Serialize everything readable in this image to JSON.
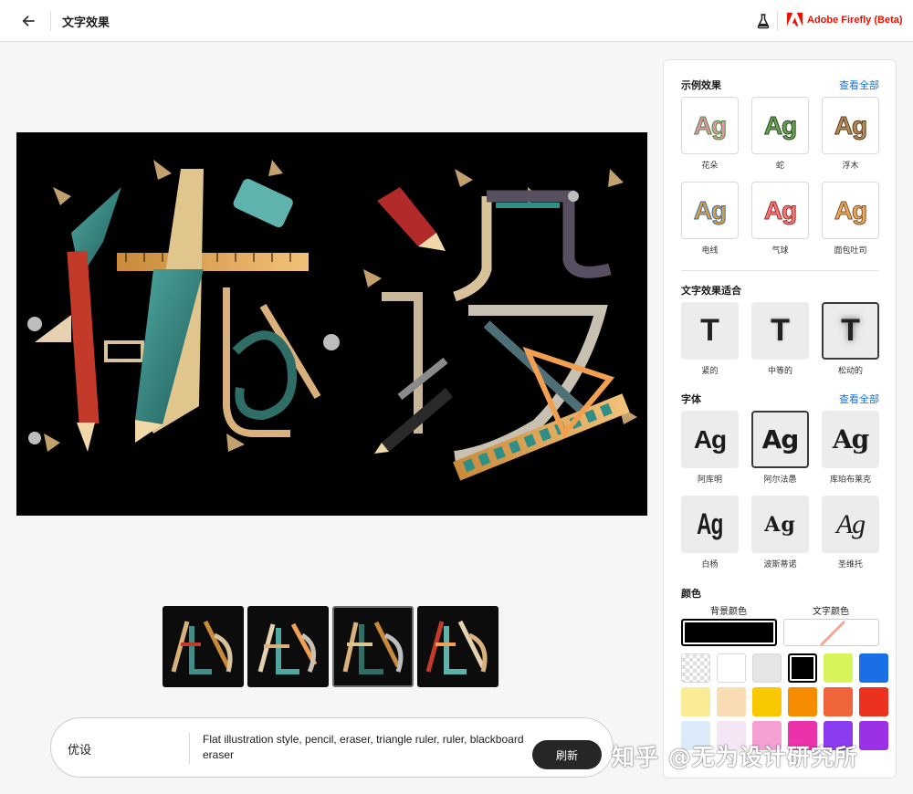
{
  "header": {
    "page_title": "文字效果",
    "brand_name": "Adobe Firefly (Beta)"
  },
  "colors": {
    "brand_red": "#eb1000",
    "link_blue": "#1473e6",
    "main_bg": "#000000"
  },
  "prompt": {
    "text": "优设",
    "description": "Flat illustration style, pencil, eraser, triangle ruler, ruler, blackboard eraser",
    "refresh_label": "刷新"
  },
  "panel": {
    "examples": {
      "title": "示例效果",
      "view_all": "查看全部",
      "items": [
        {
          "label": "花朵"
        },
        {
          "label": "蛇"
        },
        {
          "label": "浮木"
        },
        {
          "label": "电线"
        },
        {
          "label": "气球"
        },
        {
          "label": "面包吐司"
        }
      ]
    },
    "fit": {
      "title": "文字效果适合",
      "items": [
        {
          "label": "紧的"
        },
        {
          "label": "中等的"
        },
        {
          "label": "松动的",
          "selected": true
        }
      ]
    },
    "fonts": {
      "title": "字体",
      "view_all": "查看全部",
      "sample": "Ag",
      "items": [
        {
          "label": "阿库明"
        },
        {
          "label": "阿尔法愚",
          "selected": true
        },
        {
          "label": "库珀布莱克"
        },
        {
          "label": "白杨"
        },
        {
          "label": "波斯蒂诺"
        },
        {
          "label": "圣维托"
        }
      ]
    },
    "color": {
      "title": "颜色",
      "bg_label": "背景颜色",
      "text_label": "文字颜色",
      "bg_value": "#000000",
      "swatches": [
        "transparent",
        "#ffffff",
        "#e6e6e6",
        "#000000",
        "#d7f55a",
        "#1a6ee6",
        "#faeb96",
        "#fadcb4",
        "#fac800",
        "#f58c00",
        "#f0643c",
        "#eb321e",
        "#dcebfa",
        "#f5e6f5",
        "#f5a0d2",
        "#eb32aa",
        "#8c3cf0",
        "#9b30e6"
      ]
    }
  },
  "watermark": "知乎 @无为设计研究所"
}
